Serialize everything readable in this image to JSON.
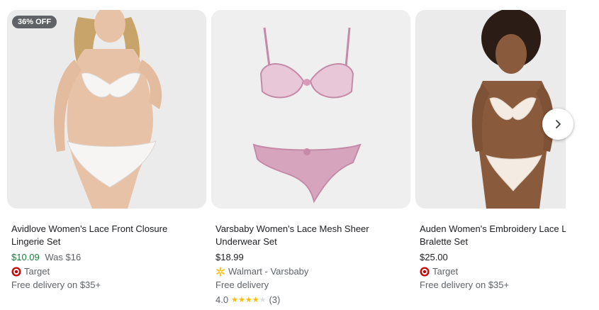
{
  "carousel": {
    "products": [
      {
        "badge": "36% OFF",
        "title": "Avidlove Women's Lace Front Closure Lingerie Set",
        "price": "$10.09",
        "was_price": "Was $16",
        "seller": "Target",
        "seller_icon": "target-logo-icon",
        "delivery": "Free delivery on $35+"
      },
      {
        "title": "Varsbaby Women's Lace Mesh Sheer Underwear Set",
        "price": "$18.99",
        "seller": "Walmart - Varsbaby",
        "seller_icon": "walmart-spark-icon",
        "delivery": "Free delivery",
        "rating": "4.0",
        "stars_filled": 4,
        "stars_total": 5,
        "review_count": "(3)"
      },
      {
        "title": "Auden Women's Embroidery Lace L Bralette Set",
        "price": "$25.00",
        "seller": "Target",
        "seller_icon": "target-logo-icon",
        "delivery": "Free delivery on $35+"
      }
    ],
    "next_icon": "chevron-right-icon"
  },
  "colors": {
    "sale_price": "#188038",
    "badge_bg": "#5f6368",
    "target_red": "#cc0000",
    "walmart_yellow": "#ffc220",
    "star": "#fbbc04"
  }
}
